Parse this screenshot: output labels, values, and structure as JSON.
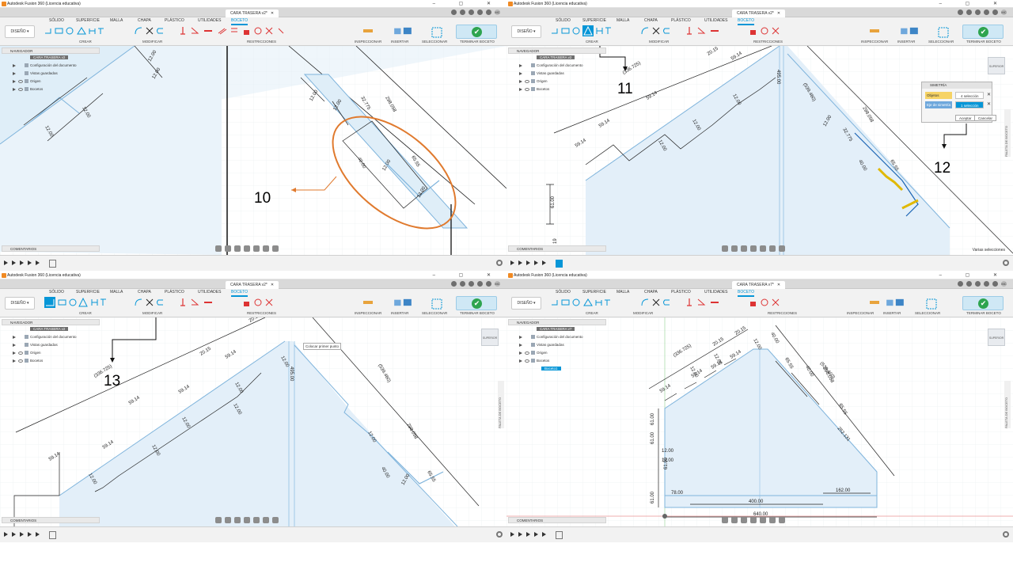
{
  "app": {
    "window_title": "Autodesk Fusion 360 (Licencia educativa)",
    "doc_tab_modified": "CARA TRASERA v2*",
    "doc_tab_final": "CARA TRASERA v7*",
    "user_initials": "MC",
    "workspace_button": "DISEÑO",
    "ribbon_tabs": [
      "SÓLIDO",
      "SUPERFICIE",
      "MALLA",
      "CHAPA",
      "PLÁSTICO",
      "UTILIDADES",
      "BOCETO"
    ],
    "groups": {
      "create": "CREAR",
      "modify": "MODIFICAR",
      "constraints": "RESTRICCIONES",
      "inspect": "INSPECCIONAR",
      "insert": "INSERTAR",
      "select": "SELECCIONAR",
      "finish": "TERMINAR BOCETO"
    },
    "accent": "#0696d7",
    "finish_color": "#2ea44f"
  },
  "navigator": {
    "header": "NAVEGADOR",
    "component": "CARA TRASERA v2",
    "component_final": "CARA TRASERA v7",
    "items": [
      "Configuración del documento",
      "Vistas guardadas",
      "Origen",
      "Bocetos"
    ],
    "sketch_item": "Boceto1"
  },
  "viewcube_label": "SUPERIOR",
  "sketch_palette_label": "PALETA DE BOCETO",
  "comments_label": "COMENTARIOS",
  "steps": [
    "10",
    "11",
    "12",
    "13"
  ],
  "dialog": {
    "title": "SIMETRÍA",
    "objects_label": "Objetos",
    "objects_value": "4 selección",
    "axis_label": "Eje de simetría",
    "axis_value": "1 selección",
    "ok": "Aceptar",
    "cancel": "Cancelar"
  },
  "status_text": "Varias selecciones",
  "tooltip": "Colocar primer punto",
  "dims": {
    "d_59_14": "59.14",
    "d_12_00": "12.00",
    "d_20_15": "20.15",
    "d_32_775": "32.775",
    "d_298_058": "298.058",
    "d_65_55": "65.55",
    "d_40_00": "40.00",
    "d_336_725": "(336.725)",
    "d_539_460": "(539.460)",
    "d_61_00": "61.00",
    "d_495_00": "495.00",
    "d_252_131": "252.131",
    "d_78_00": "78.00",
    "d_400_00": "400.00",
    "d_162_00": "162.00",
    "d_640_00": "640.00",
    "d_19": "19"
  }
}
